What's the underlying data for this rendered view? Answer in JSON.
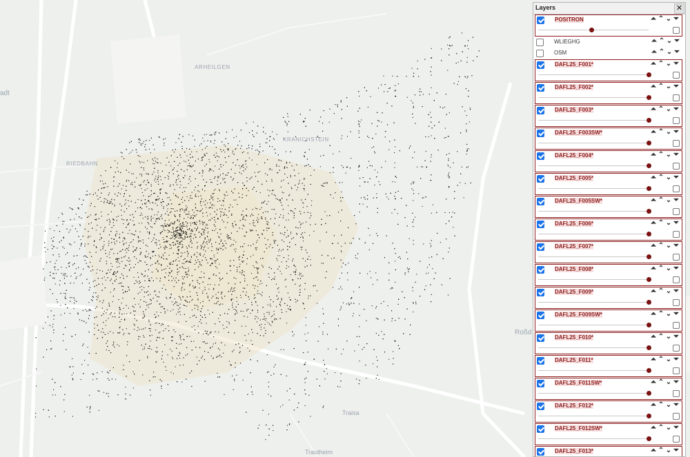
{
  "map": {
    "places": [
      "ARHEILGEN",
      "KRANICHSTEIN",
      "RIEDBAHN",
      "Traisa",
      "Trautheim",
      "Roßd",
      "adt"
    ],
    "point_color": "#111111",
    "area_color": "#efe6cc"
  },
  "panel": {
    "title": "Layers",
    "close_label": "✕",
    "layers": [
      {
        "name": "POSITRON",
        "visible": true,
        "framed": true,
        "opacity": 0.48
      },
      {
        "name": "WLIEGHG",
        "visible": false,
        "framed": false
      },
      {
        "name": "OSM",
        "visible": false,
        "framed": false
      },
      {
        "name": "DAFL25_F001*",
        "visible": true,
        "framed": true,
        "opacity": 1.0
      },
      {
        "name": "DAFL25_F002*",
        "visible": true,
        "framed": true,
        "opacity": 1.0
      },
      {
        "name": "DAFL25_F003*",
        "visible": true,
        "framed": true,
        "opacity": 1.0
      },
      {
        "name": "DAFL25_F003SW*",
        "visible": true,
        "framed": true,
        "opacity": 1.0
      },
      {
        "name": "DAFL25_F004*",
        "visible": true,
        "framed": true,
        "opacity": 1.0
      },
      {
        "name": "DAFL25_F005*",
        "visible": true,
        "framed": true,
        "opacity": 1.0
      },
      {
        "name": "DAFL25_F005SW*",
        "visible": true,
        "framed": true,
        "opacity": 1.0
      },
      {
        "name": "DAFL25_F006*",
        "visible": true,
        "framed": true,
        "opacity": 1.0
      },
      {
        "name": "DAFL25_F007*",
        "visible": true,
        "framed": true,
        "opacity": 1.0
      },
      {
        "name": "DAFL25_F008*",
        "visible": true,
        "framed": true,
        "opacity": 1.0
      },
      {
        "name": "DAFL25_F009*",
        "visible": true,
        "framed": true,
        "opacity": 1.0
      },
      {
        "name": "DAFL25_F009SW*",
        "visible": true,
        "framed": true,
        "opacity": 1.0
      },
      {
        "name": "DAFL25_F010*",
        "visible": true,
        "framed": true,
        "opacity": 1.0
      },
      {
        "name": "DAFL25_F011*",
        "visible": true,
        "framed": true,
        "opacity": 1.0
      },
      {
        "name": "DAFL25_F011SW*",
        "visible": true,
        "framed": true,
        "opacity": 1.0
      },
      {
        "name": "DAFL25_F012*",
        "visible": true,
        "framed": true,
        "opacity": 1.0
      },
      {
        "name": "DAFL25_F012SW*",
        "visible": true,
        "framed": true,
        "opacity": 1.0
      },
      {
        "name": "DAFL25_F013*",
        "visible": true,
        "framed": true,
        "opacity": 1.0
      }
    ],
    "controls": {
      "top_icon": "double-chevron-up-icon",
      "up_icon": "chevron-up-icon",
      "down_icon": "chevron-down-icon",
      "bottom_icon": "double-chevron-down-icon"
    }
  }
}
